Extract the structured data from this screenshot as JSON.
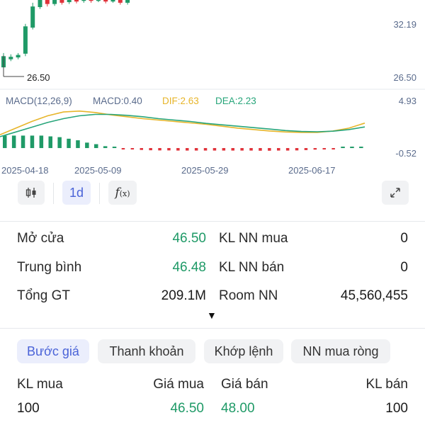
{
  "chart_data": {
    "type": "candlestick",
    "price_labels": [
      "32.19",
      "26.50"
    ],
    "low_marker": "26.50",
    "dates": [
      "2025-04-18",
      "2025-05-09",
      "2025-05-29",
      "2025-06-17"
    ],
    "macd": {
      "title": "MACD(12,26,9)",
      "macd_text": "MACD:0.40",
      "dif_text": "DIF:2.63",
      "dea_text": "DEA:2.23",
      "axis_max": "4.93",
      "axis_min": "-0.52",
      "ylim": [
        -0.52,
        4.93
      ],
      "histogram": [
        0.8,
        0.8,
        0.8,
        0.8,
        0.8,
        0.75,
        0.7,
        0.6,
        0.5,
        0.35,
        0.25,
        0.12,
        0.04,
        -0.04,
        -0.08,
        -0.12,
        -0.14,
        -0.15,
        -0.15,
        -0.16,
        -0.16,
        -0.16,
        -0.16,
        -0.16,
        -0.16,
        -0.16,
        -0.16,
        -0.16,
        -0.17,
        -0.17,
        -0.16,
        -0.16,
        -0.15,
        -0.13,
        -0.1,
        -0.06,
        -0.02,
        0.02,
        0.04,
        0.06
      ],
      "dif": [
        1.4,
        2.1,
        2.8,
        3.4,
        3.8,
        3.9,
        3.75,
        3.5,
        3.3,
        3.1,
        2.95,
        2.8,
        2.65,
        2.5,
        2.3,
        2.1,
        1.95,
        1.8,
        1.7,
        1.65,
        1.65,
        1.8,
        2.1,
        2.63
      ],
      "dea": [
        1.2,
        1.7,
        2.2,
        2.7,
        3.1,
        3.4,
        3.55,
        3.55,
        3.45,
        3.3,
        3.1,
        2.95,
        2.8,
        2.6,
        2.45,
        2.3,
        2.15,
        2.0,
        1.85,
        1.75,
        1.72,
        1.78,
        1.95,
        2.23
      ]
    },
    "candles": [
      {
        "o": 28.2,
        "c": 30.0,
        "h": 30.5,
        "l": 27.8
      },
      {
        "o": 29.5,
        "c": 29.9,
        "h": 30.3,
        "l": 29.2
      },
      {
        "o": 29.8,
        "c": 30.2,
        "h": 30.5,
        "l": 29.5
      },
      {
        "o": 30.4,
        "c": 34.8,
        "h": 35.2,
        "l": 30.0
      },
      {
        "o": 34.6,
        "c": 38.0,
        "h": 38.6,
        "l": 34.3
      },
      {
        "o": 37.9,
        "c": 39.3,
        "h": 39.8,
        "l": 37.6
      },
      {
        "o": 39.3,
        "c": 38.4,
        "h": 39.9,
        "l": 38.0
      },
      {
        "o": 38.4,
        "c": 39.6,
        "h": 40.0,
        "l": 38.1
      },
      {
        "o": 39.5,
        "c": 38.6,
        "h": 39.9,
        "l": 38.3
      },
      {
        "o": 38.7,
        "c": 39.5,
        "h": 39.9,
        "l": 38.4
      },
      {
        "o": 39.4,
        "c": 38.8,
        "h": 39.8,
        "l": 38.5
      },
      {
        "o": 38.9,
        "c": 39.4,
        "h": 39.7,
        "l": 38.6
      },
      {
        "o": 39.3,
        "c": 38.9,
        "h": 39.6,
        "l": 38.6
      },
      {
        "o": 38.9,
        "c": 39.4,
        "h": 39.8,
        "l": 38.7
      },
      {
        "o": 39.3,
        "c": 38.8,
        "h": 39.7,
        "l": 38.5
      },
      {
        "o": 38.8,
        "c": 39.5,
        "h": 39.9,
        "l": 38.6
      },
      {
        "o": 39.5,
        "c": 38.6,
        "h": 39.8,
        "l": 38.3
      },
      {
        "o": 38.6,
        "c": 39.8,
        "h": 40.1,
        "l": 38.3
      }
    ],
    "candle_ylim": [
      26.5,
      39.5
    ],
    "colors": {
      "up": "#1f9a67",
      "down": "#e0323a",
      "dif": "#e7b52a",
      "dea": "#27a57a",
      "axis": "#5a6b8c"
    }
  },
  "toolbar": {
    "candle_icon": "candlestick-icon",
    "interval": "1d",
    "indicator_icon": "fx-icon",
    "fullscreen_icon": "expand-icon"
  },
  "stats": {
    "open_label": "Mở cửa",
    "open_value": "46.50",
    "avg_label": "Trung bình",
    "avg_value": "46.48",
    "total_label": "Tổng GT",
    "total_value": "209.1M",
    "foreign_buy_label": "KL NN mua",
    "foreign_buy_value": "0",
    "foreign_sell_label": "KL NN bán",
    "foreign_sell_value": "0",
    "room_label": "Room NN",
    "room_value": "45,560,455",
    "expand_arrow": "▼"
  },
  "tabs": [
    "Bước giá",
    "Thanh khoản",
    "Khớp lệnh",
    "NN mua ròng"
  ],
  "orderbook": {
    "headers": [
      "KL mua",
      "Giá mua",
      "Giá bán",
      "KL bán"
    ],
    "rows": [
      {
        "buy_vol": "100",
        "buy_price": "46.50",
        "sell_price": "48.00",
        "sell_vol": "100"
      }
    ]
  }
}
